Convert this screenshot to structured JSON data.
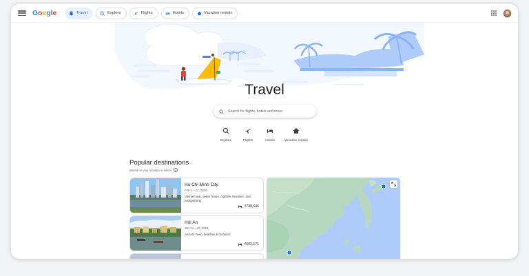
{
  "header": {
    "logo": "Google",
    "nav": [
      {
        "label": "Travel",
        "icon": "travel-icon",
        "active": true
      },
      {
        "label": "Explore",
        "icon": "explore-icon",
        "active": false
      },
      {
        "label": "Flights",
        "icon": "flight-icon",
        "active": false
      },
      {
        "label": "Hotels",
        "icon": "hotel-icon",
        "active": false
      },
      {
        "label": "Vacation rentals",
        "icon": "home-icon",
        "active": false
      }
    ]
  },
  "hero": {
    "title": "Travel"
  },
  "search": {
    "placeholder": "Search for flights, hotels and more"
  },
  "quick_links": [
    {
      "label": "Explore",
      "icon": "explore-icon"
    },
    {
      "label": "Flights",
      "icon": "flight-icon"
    },
    {
      "label": "Hotels",
      "icon": "hotel-icon"
    },
    {
      "label": "Vacation rentals",
      "icon": "home-icon"
    }
  ],
  "popular": {
    "title": "Popular destinations",
    "subtitle": "Based on your location in Hanoi",
    "destinations": [
      {
        "name": "Ho Chi Minh City",
        "dates": "Feb 4 – 17, 2024",
        "description": "Vietnam war, opera house, nightlife, literature, and backpacking",
        "price": "₫738,646"
      },
      {
        "name": "Hội An",
        "dates": "Jan 14 – 20, 2024",
        "description": "Ancient Town, beaches & ceramics",
        "price": "₫602,171"
      }
    ]
  },
  "colors": {
    "accent": "#1a73e8",
    "active_chip_bg": "#e8f0fe",
    "hero_blue": "#aecbfa",
    "yellow": "#fbbc04",
    "red": "#ea4335"
  }
}
